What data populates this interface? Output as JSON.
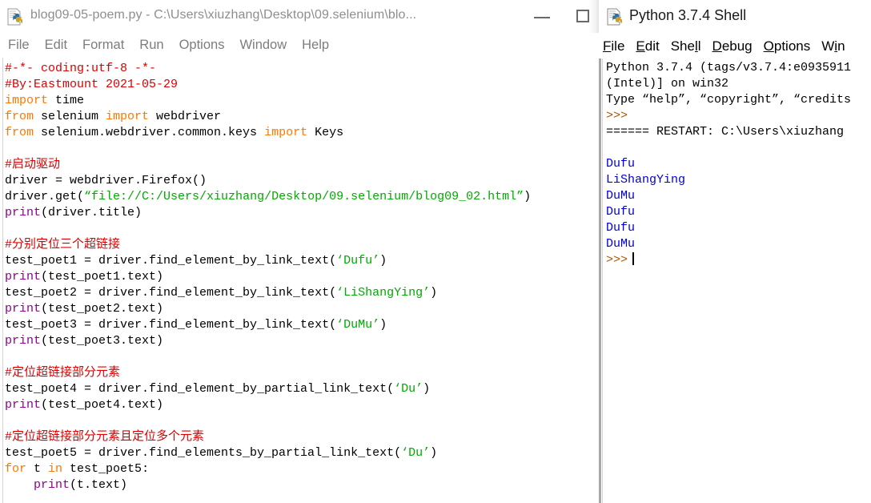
{
  "editor_window": {
    "title": "blog09-05-poem.py - C:\\Users\\xiuzhang\\Desktop\\09.selenium\\blo...",
    "icon": "python-file-icon",
    "controls": {
      "minimize_label": "—",
      "maximize_label": "□"
    },
    "menu": [
      {
        "label": "File"
      },
      {
        "label": "Edit"
      },
      {
        "label": "Format"
      },
      {
        "label": "Run"
      },
      {
        "label": "Options"
      },
      {
        "label": "Window"
      },
      {
        "label": "Help"
      }
    ],
    "code_lines": [
      [
        {
          "t": "#-*- coding:utf-8 -*-",
          "c": "comment"
        }
      ],
      [
        {
          "t": "#By:Eastmount 2021-05-29",
          "c": "comment"
        }
      ],
      [
        {
          "t": "import",
          "c": "keyword"
        },
        {
          "t": " time",
          "c": "plain"
        }
      ],
      [
        {
          "t": "from",
          "c": "keyword"
        },
        {
          "t": " selenium ",
          "c": "plain"
        },
        {
          "t": "import",
          "c": "keyword"
        },
        {
          "t": " webdriver",
          "c": "plain"
        }
      ],
      [
        {
          "t": "from",
          "c": "keyword"
        },
        {
          "t": " selenium.webdriver.common.keys ",
          "c": "plain"
        },
        {
          "t": "import",
          "c": "keyword"
        },
        {
          "t": " Keys",
          "c": "plain"
        }
      ],
      [
        {
          "t": "",
          "c": "plain"
        }
      ],
      [
        {
          "t": "#启动驱动",
          "c": "comment"
        }
      ],
      [
        {
          "t": "driver = webdriver.Firefox()",
          "c": "plain"
        }
      ],
      [
        {
          "t": "driver.get(",
          "c": "plain"
        },
        {
          "t": "“file://C:/Users/xiuzhang/Desktop/09.selenium/blog09_02.html”",
          "c": "string"
        },
        {
          "t": ")",
          "c": "plain"
        }
      ],
      [
        {
          "t": "print",
          "c": "builtin"
        },
        {
          "t": "(driver.title)",
          "c": "plain"
        }
      ],
      [
        {
          "t": "",
          "c": "plain"
        }
      ],
      [
        {
          "t": "#分别定位三个超链接",
          "c": "comment"
        }
      ],
      [
        {
          "t": "test_poet1 = driver.find_element_by_link_text(",
          "c": "plain"
        },
        {
          "t": "‘Dufu’",
          "c": "string"
        },
        {
          "t": ")",
          "c": "plain"
        }
      ],
      [
        {
          "t": "print",
          "c": "builtin"
        },
        {
          "t": "(test_poet1.text)",
          "c": "plain"
        }
      ],
      [
        {
          "t": "test_poet2 = driver.find_element_by_link_text(",
          "c": "plain"
        },
        {
          "t": "‘LiShangYing’",
          "c": "string"
        },
        {
          "t": ")",
          "c": "plain"
        }
      ],
      [
        {
          "t": "print",
          "c": "builtin"
        },
        {
          "t": "(test_poet2.text)",
          "c": "plain"
        }
      ],
      [
        {
          "t": "test_poet3 = driver.find_element_by_link_text(",
          "c": "plain"
        },
        {
          "t": "‘DuMu’",
          "c": "string"
        },
        {
          "t": ")",
          "c": "plain"
        }
      ],
      [
        {
          "t": "print",
          "c": "builtin"
        },
        {
          "t": "(test_poet3.text)",
          "c": "plain"
        }
      ],
      [
        {
          "t": "",
          "c": "plain"
        }
      ],
      [
        {
          "t": "#定位超链接部分元素",
          "c": "comment"
        }
      ],
      [
        {
          "t": "test_poet4 = driver.find_element_by_partial_link_text(",
          "c": "plain"
        },
        {
          "t": "‘Du’",
          "c": "string"
        },
        {
          "t": ")",
          "c": "plain"
        }
      ],
      [
        {
          "t": "print",
          "c": "builtin"
        },
        {
          "t": "(test_poet4.text)",
          "c": "plain"
        }
      ],
      [
        {
          "t": "",
          "c": "plain"
        }
      ],
      [
        {
          "t": "#定位超链接部分元素且定位多个元素",
          "c": "comment"
        }
      ],
      [
        {
          "t": "test_poet5 = driver.find_elements_by_partial_link_text(",
          "c": "plain"
        },
        {
          "t": "‘Du’",
          "c": "string"
        },
        {
          "t": ")",
          "c": "plain"
        }
      ],
      [
        {
          "t": "for",
          "c": "keyword"
        },
        {
          "t": " t ",
          "c": "plain"
        },
        {
          "t": "in",
          "c": "keyword"
        },
        {
          "t": " test_poet5:",
          "c": "plain"
        }
      ],
      [
        {
          "t": "    ",
          "c": "plain"
        },
        {
          "t": "print",
          "c": "builtin"
        },
        {
          "t": "(t.text)",
          "c": "plain"
        }
      ]
    ]
  },
  "shell_window": {
    "title": "Python 3.7.4 Shell",
    "icon": "python-shell-icon",
    "menu": [
      {
        "pre": "",
        "acc": "F",
        "post": "ile"
      },
      {
        "pre": "",
        "acc": "E",
        "post": "dit"
      },
      {
        "pre": "She",
        "acc": "l",
        "post": "l"
      },
      {
        "pre": "",
        "acc": "D",
        "post": "ebug"
      },
      {
        "pre": "",
        "acc": "O",
        "post": "ptions"
      },
      {
        "pre": "W",
        "acc": "i",
        "post": "n"
      }
    ],
    "output_lines": [
      [
        {
          "t": "Python 3.7.4 (tags/v3.7.4:e0935911",
          "c": "plain"
        }
      ],
      [
        {
          "t": "(Intel)] on win32",
          "c": "plain"
        }
      ],
      [
        {
          "t": "Type “help”, “copyright”, “credits",
          "c": "plain"
        }
      ],
      [
        {
          "t": ">>>",
          "c": "prompt"
        }
      ],
      [
        {
          "t": "====== RESTART: C:\\Users\\xiuzhang",
          "c": "restart"
        }
      ],
      [
        {
          "t": "",
          "c": "plain"
        }
      ],
      [
        {
          "t": "Dufu",
          "c": "stdout"
        }
      ],
      [
        {
          "t": "LiShangYing",
          "c": "stdout"
        }
      ],
      [
        {
          "t": "DuMu",
          "c": "stdout"
        }
      ],
      [
        {
          "t": "Dufu",
          "c": "stdout"
        }
      ],
      [
        {
          "t": "Dufu",
          "c": "stdout"
        }
      ],
      [
        {
          "t": "DuMu",
          "c": "stdout"
        }
      ],
      [
        {
          "t": ">>>",
          "c": "prompt",
          "caret": true
        }
      ]
    ]
  },
  "colors": {
    "comment": "#dd0000",
    "keyword": "#ff7700",
    "builtin": "#900090",
    "string": "#00aa00",
    "stdout": "#0000dd",
    "prompt": "#aa5500",
    "inactive_title": "#8e8e8e",
    "active_title": "#1a1a1a"
  }
}
